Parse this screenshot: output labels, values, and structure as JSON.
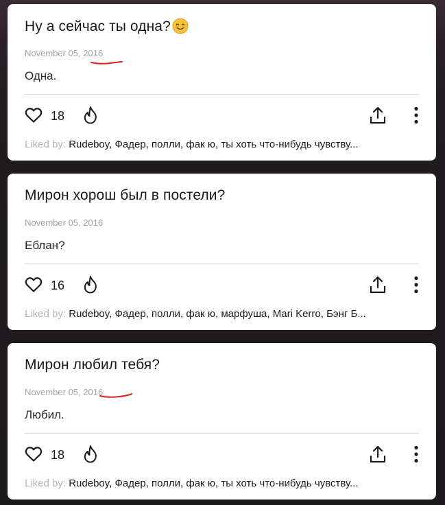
{
  "posts": [
    {
      "question": "Ну а сейчас ты одна?",
      "emoji": "smiling-face-emoji",
      "date": "November 05, 2016",
      "answer": "Одна.",
      "likes": "18",
      "liked_by_label": "Liked by:",
      "liked_by_names": "Rudeboy, Фадер, полли, фак ю, ты хоть что-нибудь чувству..."
    },
    {
      "question": "Мирон хорош был в постели?",
      "date": "November 05, 2016",
      "answer": "Еблан?",
      "likes": "16",
      "liked_by_label": "Liked by:",
      "liked_by_names": "Rudeboy, Фадер, полли, фак ю, марфуша, Mari Kerro, Бэнг Б..."
    },
    {
      "question": "Мирон любил тебя?",
      "date": "November 05, 2016",
      "answer": "Любил.",
      "likes": "18",
      "liked_by_label": "Liked by:",
      "liked_by_names": "Rudeboy, Фадер, полли, фак ю, ты хоть что-нибудь чувству..."
    }
  ],
  "colors": {
    "background": "#1d1a1d",
    "card": "#ffffff",
    "text": "#1a1a1a",
    "muted": "#a3a3a3",
    "annotation_underline": "#d81e1e",
    "emoji_face": "#f7c23a"
  },
  "icons": [
    "heart-icon",
    "fire-icon",
    "share-icon",
    "more-vertical-icon"
  ]
}
